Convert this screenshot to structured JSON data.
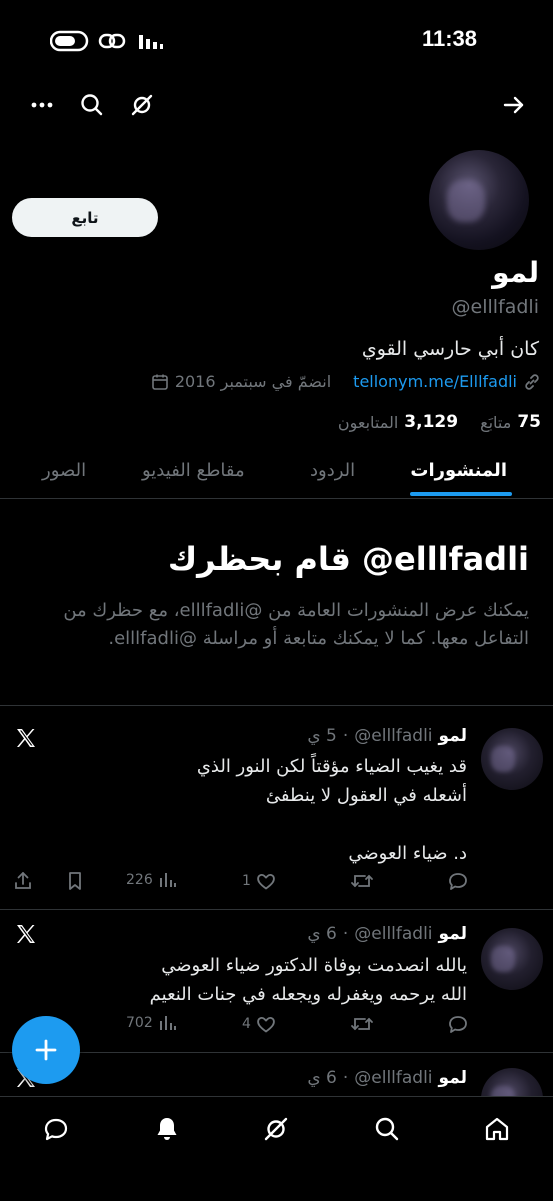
{
  "status_bar": {
    "time": "11:38"
  },
  "profile": {
    "follow_label": "تابع",
    "name": "لمو",
    "handle": "@elllfadli",
    "bio": "كان أبي حارسي القوي",
    "link": "tellonym.me/Elllfadli",
    "joined": "انضمّ في سبتمبر 2016",
    "followers_count": "3,129",
    "followers_label": "المتابعون",
    "following_count": "75",
    "following_label": "متابَع"
  },
  "tabs": [
    "المنشورات",
    "الردود",
    "مقاطع الفيديو",
    "الصور"
  ],
  "blocked": {
    "title": "قام بحظرك @elllfadli",
    "body": "يمكنك عرض المنشورات العامة من @elllfadli، مع حظرك من التفاعل معها. كما لا يمكنك متابعة أو مراسلة @elllfadli."
  },
  "tweets": [
    {
      "name": "لمو",
      "handle": "@elllfadli",
      "time": "5 ي",
      "lines": [
        "قد يغيب الضياء مؤقتاً لكن النور الذي",
        "أشعله في العقول لا ينطفئ",
        "",
        "د. ضياء العوضي"
      ],
      "views": "226",
      "likes": "1"
    },
    {
      "name": "لمو",
      "handle": "@elllfadli",
      "time": "6 ي",
      "lines": [
        "يالله انصدمت بوفاة الدكتور ضياء العوضي",
        "الله يرحمه ويغفرله ويجعله في جنات النعيم"
      ],
      "views": "702",
      "likes": "4"
    },
    {
      "name": "لمو",
      "handle": "@elllfadli",
      "time": "6 ي",
      "lines": []
    }
  ],
  "icons": {
    "header": [
      "more-icon",
      "search-icon",
      "grok-icon",
      "back-arrow-icon"
    ],
    "nav": [
      "messages-icon",
      "notifications-icon",
      "grok-icon",
      "search-icon",
      "home-icon"
    ]
  },
  "colors": {
    "accent": "#1d9bf0",
    "background": "#000000",
    "muted": "#71767b"
  }
}
